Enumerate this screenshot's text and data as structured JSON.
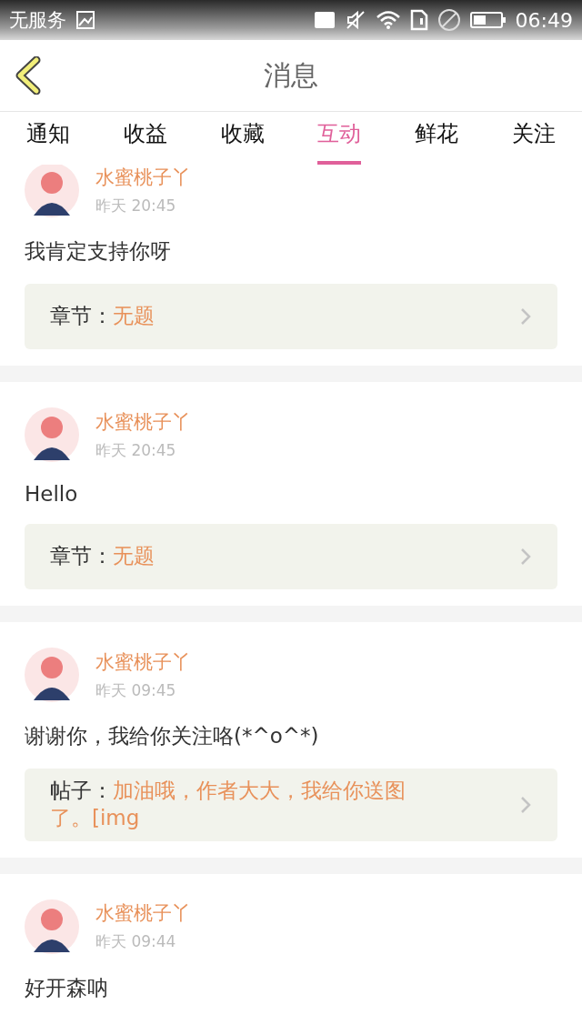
{
  "status_bar": {
    "carrier": "无服务",
    "time": "06:49"
  },
  "header": {
    "title": "消息"
  },
  "tabs": [
    {
      "label": "通知",
      "selected": false
    },
    {
      "label": "收益",
      "selected": false
    },
    {
      "label": "收藏",
      "selected": false
    },
    {
      "label": "互动",
      "selected": true
    },
    {
      "label": "鲜花",
      "selected": false
    },
    {
      "label": "关注",
      "selected": false
    }
  ],
  "messages": [
    {
      "user": "水蜜桃子丫",
      "time": "昨天 20:45",
      "text": "我肯定支持你呀",
      "quote": {
        "label": "章节：",
        "title": "无题"
      }
    },
    {
      "user": "水蜜桃子丫",
      "time": "昨天 20:45",
      "text": "Hello",
      "quote": {
        "label": "章节：",
        "title": "无题"
      }
    },
    {
      "user": "水蜜桃子丫",
      "time": "昨天 09:45",
      "text": "谢谢你，我给你关注咯(*^o^*)",
      "quote": {
        "label": "帖子：",
        "title": "加油哦，作者大大，我给你送图了。[img"
      }
    },
    {
      "user": "水蜜桃子丫",
      "time": "昨天 09:44",
      "text": "好开森呐"
    }
  ]
}
